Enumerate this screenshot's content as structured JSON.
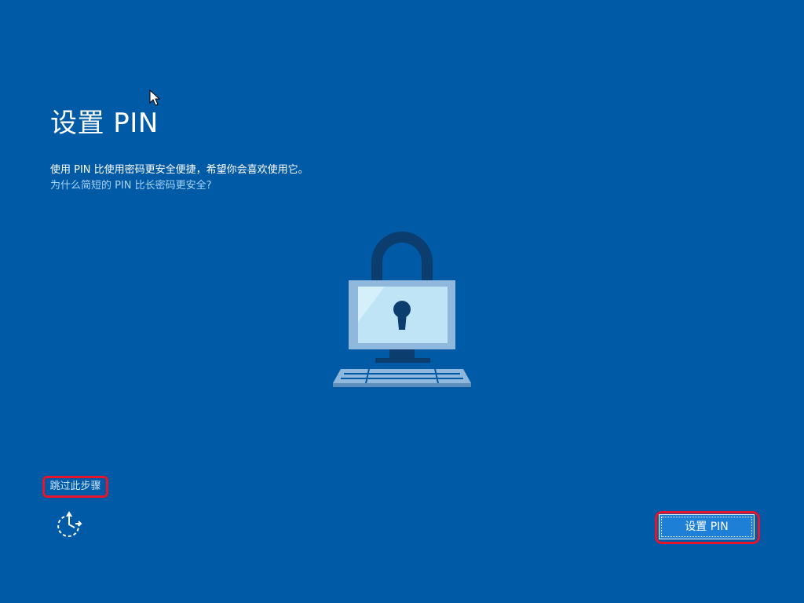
{
  "page": {
    "title": "设置 PIN",
    "description": "使用 PIN 比使用密码更安全便捷，希望你会喜欢使用它。",
    "why_link": "为什么简短的 PIN 比长密码更安全?"
  },
  "footer": {
    "skip_label": "跳过此步骤",
    "ease_of_access_icon": "ease-of-access-icon"
  },
  "actions": {
    "setup_pin_label": "设置 PIN"
  },
  "illustration": {
    "icon": "padlock-computer-icon"
  },
  "colors": {
    "background": "#005aa6",
    "link": "#a8d4ff",
    "button": "#1e7fd6",
    "highlight_outline": "#e8142b"
  }
}
